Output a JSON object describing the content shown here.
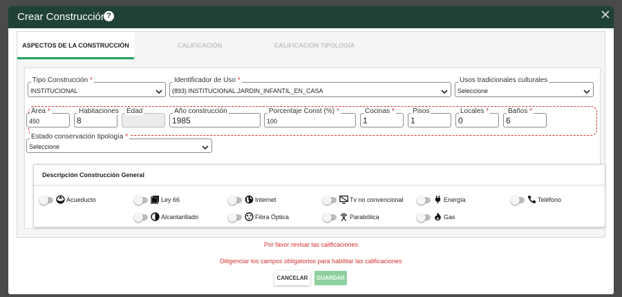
{
  "modal": {
    "title": "Crear Construcción",
    "help_icon": "?",
    "close_icon": "✕"
  },
  "tabs": [
    {
      "label": "ASPECTOS DE LA CONSTRUCCIÓN",
      "active": true
    },
    {
      "label": "CALIFICACIÓN",
      "active": false
    },
    {
      "label": "CALIFICACIÓN TIPOLOGÍA",
      "active": false
    }
  ],
  "fields": {
    "tipo_construccion": {
      "label": "Tipo Construcción",
      "value": "INSTITUCIONAL"
    },
    "identificador_uso": {
      "label": "Identificador de Uso",
      "value": "(893) INSTITUCIONAL.JARDIN_INFANTIL_EN_CASA"
    },
    "usos_tradicionales": {
      "label": "Usos tradicionales culturales",
      "value": "Seleccione"
    },
    "area": {
      "label": "Área",
      "value": "450"
    },
    "habitaciones": {
      "label": "Habitaciones",
      "value": "8"
    },
    "edad": {
      "label": "Edad",
      "value": ""
    },
    "anio_construccion": {
      "label": "Año construcción",
      "value": "1985"
    },
    "porcentaje_const": {
      "label": "Porcentaje Const (%)",
      "value": "100"
    },
    "cocinas": {
      "label": "Cocinas",
      "value": "1"
    },
    "pisos": {
      "label": "Pisos",
      "value": "1"
    },
    "locales": {
      "label": "Locales",
      "value": "0"
    },
    "banos": {
      "label": "Baños",
      "value": "6"
    },
    "estado_conservacion": {
      "label": "Estado conservación tipología",
      "value": "Seleccione"
    },
    "required_mark": "*"
  },
  "section": {
    "title": "Descripción Construcción General",
    "services": [
      {
        "label": "Acueducto",
        "icon": "water-drop-icon",
        "on": false
      },
      {
        "label": "Ley 66",
        "icon": "books-icon",
        "on": false
      },
      {
        "label": "Internet",
        "icon": "globe-icon",
        "on": false
      },
      {
        "label": "Tv no convencional",
        "icon": "tv-icon",
        "on": false
      },
      {
        "label": "Energía",
        "icon": "plug-icon",
        "on": false
      },
      {
        "label": "Teléfono",
        "icon": "phone-icon",
        "on": false
      },
      {
        "label": "Alcantarillado",
        "icon": "half-circle-icon",
        "on": false
      },
      {
        "label": "Fibra Óptica",
        "icon": "fiber-optic-icon",
        "on": false
      },
      {
        "label": "Parabólica",
        "icon": "satellite-icon",
        "on": false
      },
      {
        "label": "Gas",
        "icon": "flame-icon",
        "on": false
      }
    ]
  },
  "messages": {
    "review": "Por favor revisar las calificaciones",
    "required": "Diligenciar los campos obligatorios para habilitar las calificaciones"
  },
  "buttons": {
    "cancel": "CANCELAR",
    "save": "GUARDAR"
  },
  "colors": {
    "header": "#1f4235",
    "accent": "#23a05a",
    "error": "#d32f2f",
    "save_disabled": "#8ecf9f"
  }
}
